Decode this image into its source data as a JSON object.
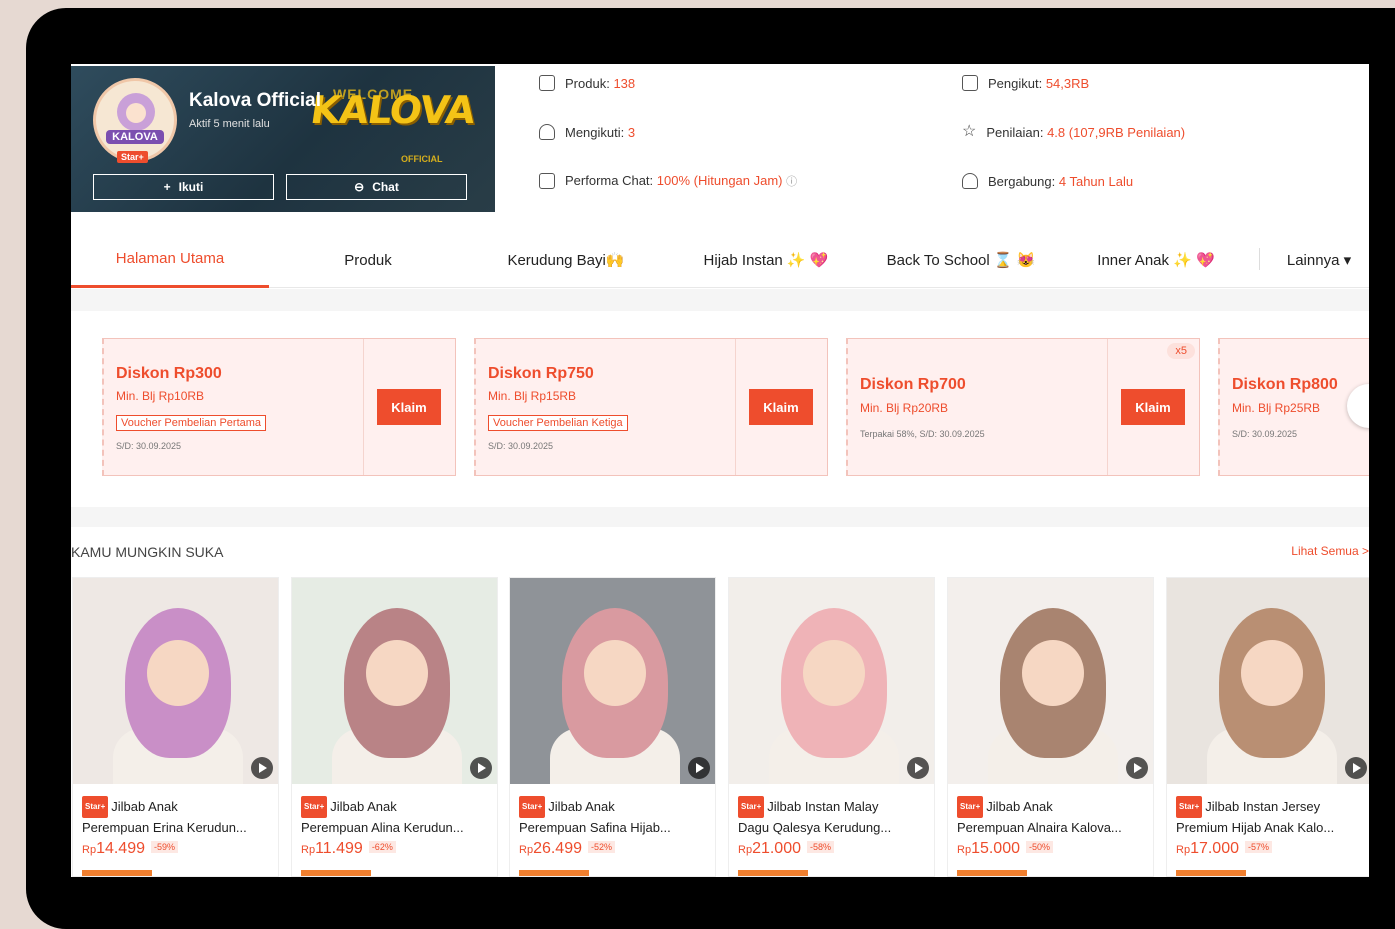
{
  "shop": {
    "name": "Kalova Official",
    "active": "Aktif 5 menit lalu",
    "badge": "Star+",
    "logo_text": "KALOVA",
    "banner_welcome": "WELCOME",
    "banner_brand": "KALOVA",
    "banner_official": "OFFICIAL",
    "follow_label": "Ikuti",
    "chat_label": "Chat"
  },
  "stats": [
    {
      "label": "Produk:",
      "value": "138",
      "icon": "store-icon"
    },
    {
      "label": "Mengikuti:",
      "value": "3",
      "icon": "person-icon"
    },
    {
      "label": "Performa Chat:",
      "value": "100% (Hitungan Jam)",
      "icon": "chat-icon"
    },
    {
      "label": "Pengikut:",
      "value": "54,3RB",
      "icon": "followers-icon"
    },
    {
      "label": "Penilaian:",
      "value": "4.8 (107,9RB Penilaian)",
      "icon": "star-icon"
    },
    {
      "label": "Bergabung:",
      "value": "4 Tahun Lalu",
      "icon": "person-icon"
    }
  ],
  "tabs": [
    {
      "label": "Halaman Utama",
      "active": true
    },
    {
      "label": "Produk"
    },
    {
      "label": "Kerudung Bayi🙌"
    },
    {
      "label": "Hijab Instan ✨ 💖"
    },
    {
      "label": "Back To School ⌛ 😻"
    },
    {
      "label": "Inner Anak ✨ 💖"
    },
    {
      "label": "Lainnya ▾"
    }
  ],
  "vouchers": [
    {
      "title": "Diskon Rp300",
      "min": "Min. Blj Rp10RB",
      "tag": "Voucher Pembelian Pertama",
      "date": "S/D: 30.09.2025",
      "button": "Klaim"
    },
    {
      "title": "Diskon Rp750",
      "min": "Min. Blj Rp15RB",
      "tag": "Voucher Pembelian Ketiga",
      "date": "S/D: 30.09.2025",
      "button": "Klaim"
    },
    {
      "title": "Diskon Rp700",
      "min": "Min. Blj Rp20RB",
      "date": "Terpakai 58%, S/D: 30.09.2025",
      "button": "Klaim",
      "multiplier": "x5"
    },
    {
      "title": "Diskon Rp800",
      "min": "Min. Blj Rp25RB",
      "date": "S/D: 30.09.2025"
    }
  ],
  "section": {
    "title": "KAMU MUNGKIN SUKA",
    "see_all": "Lihat Semua >"
  },
  "products": [
    {
      "badge": "Star+",
      "line1": "Jilbab Anak",
      "line2": "Perempuan Erina Kerudun...",
      "currency": "Rp",
      "price": "14.499",
      "discount": "-59%",
      "hijab": "#c98fc7",
      "bg": "#eee8e4"
    },
    {
      "badge": "Star+",
      "line1": "Jilbab Anak",
      "line2": "Perempuan Alina Kerudun...",
      "currency": "Rp",
      "price": "11.499",
      "discount": "-62%",
      "hijab": "#b98386",
      "bg": "#e6ece4"
    },
    {
      "badge": "Star+",
      "line1": "Jilbab Anak",
      "line2": "Perempuan Safina Hijab...",
      "currency": "Rp",
      "price": "26.499",
      "discount": "-52%",
      "hijab": "#d99aa0",
      "bg": "#8f9398"
    },
    {
      "badge": "Star+",
      "line1": "Jilbab Instan Malay",
      "line2": "Dagu Qalesya Kerudung...",
      "currency": "Rp",
      "price": "21.000",
      "discount": "-58%",
      "hijab": "#efb3b7",
      "bg": "#f2eeea"
    },
    {
      "badge": "Star+",
      "line1": "Jilbab Anak",
      "line2": "Perempuan Alnaira Kalova...",
      "currency": "Rp",
      "price": "15.000",
      "discount": "-50%",
      "hijab": "#a98470",
      "bg": "#f3efec"
    },
    {
      "badge": "Star+",
      "line1": "Jilbab Instan Jersey",
      "line2": "Premium Hijab Anak Kalo...",
      "currency": "Rp",
      "price": "17.000",
      "discount": "-57%",
      "hijab": "#b98f73",
      "bg": "#e9e4df"
    }
  ]
}
